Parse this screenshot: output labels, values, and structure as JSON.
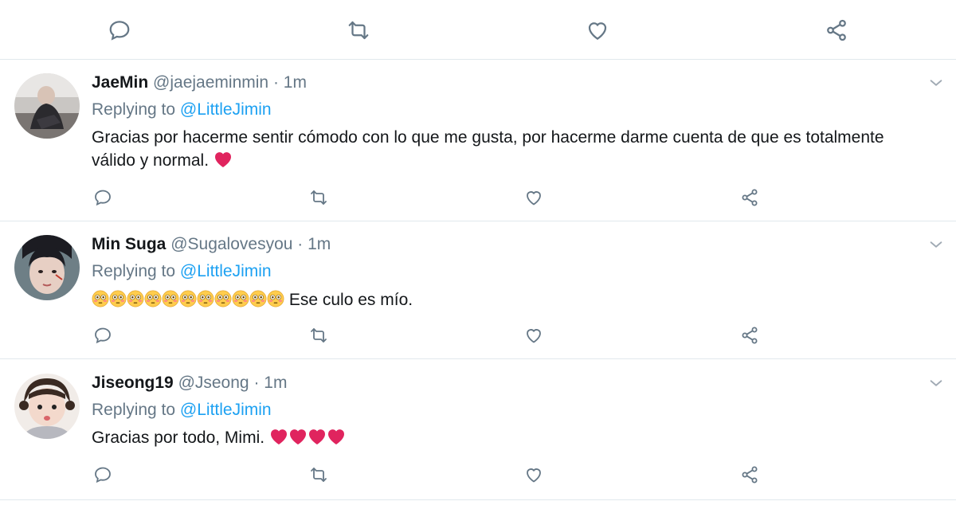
{
  "top_actions": {
    "icons": [
      "reply-icon",
      "retweet-icon",
      "like-icon",
      "share-icon"
    ]
  },
  "tweets": [
    {
      "name": "JaeMin",
      "handle": "@jaejaeminmin",
      "sep": "·",
      "time": "1m",
      "replying_prefix": "Replying to ",
      "replying_to": "@LittleJimin",
      "text": "Gracias por hacerme sentir cómodo con lo que me gusta, por hacerme darme cuenta de que es totalmente válido y normal.",
      "trailing_emoji": [
        "red-heart"
      ]
    },
    {
      "name": "Min Suga",
      "handle": "@Sugalovesyou",
      "sep": "·",
      "time": "1m",
      "replying_prefix": "Replying to ",
      "replying_to": "@LittleJimin",
      "leading_emoji_count": 11,
      "leading_emoji": "flushed-face",
      "text": "Ese culo es mío."
    },
    {
      "name": "Jiseong19",
      "handle": "@Jseong",
      "sep": "·",
      "time": "1m",
      "replying_prefix": "Replying to ",
      "replying_to": "@LittleJimin",
      "text": "Gracias por todo, Mimi.",
      "trailing_emoji": [
        "red-heart",
        "red-heart",
        "red-heart",
        "red-heart"
      ]
    }
  ],
  "colors": {
    "link": "#1da1f2",
    "secondary_text": "#657786",
    "divider": "#e1e8ed",
    "heart_red": "#e0245e"
  }
}
